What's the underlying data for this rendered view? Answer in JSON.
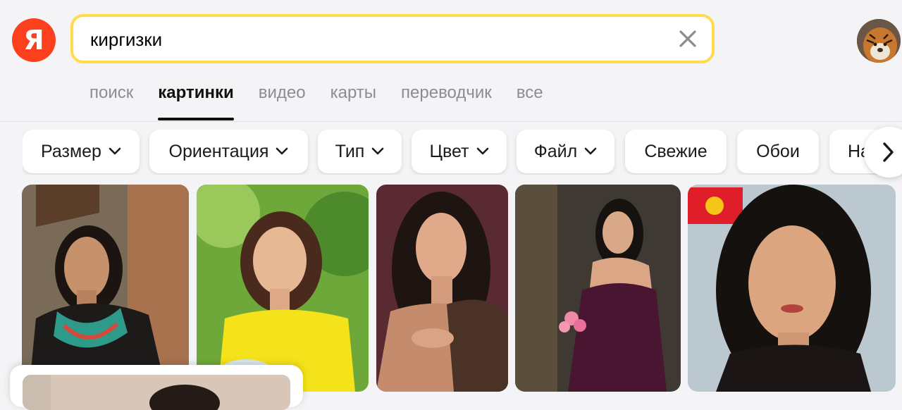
{
  "logo": {
    "letter": "Я"
  },
  "search": {
    "query": "киргизки"
  },
  "tabs": [
    {
      "label": "поиск",
      "active": false
    },
    {
      "label": "картинки",
      "active": true
    },
    {
      "label": "видео",
      "active": false
    },
    {
      "label": "карты",
      "active": false
    },
    {
      "label": "переводчик",
      "active": false
    },
    {
      "label": "все",
      "active": false
    }
  ],
  "filters": [
    {
      "label": "Размер",
      "dropdown": true
    },
    {
      "label": "Ориентация",
      "dropdown": true
    },
    {
      "label": "Тип",
      "dropdown": true
    },
    {
      "label": "Цвет",
      "dropdown": true
    },
    {
      "label": "Файл",
      "dropdown": true
    },
    {
      "label": "Свежие",
      "dropdown": false
    },
    {
      "label": "Обои",
      "dropdown": false
    },
    {
      "label": "На",
      "dropdown": false
    }
  ],
  "colors": {
    "accent": "#ffdb4d",
    "logo": "#fc3f1d"
  },
  "icons": [
    "yandex-logo",
    "close-icon",
    "chevron-down-icon",
    "chevron-right-icon"
  ]
}
